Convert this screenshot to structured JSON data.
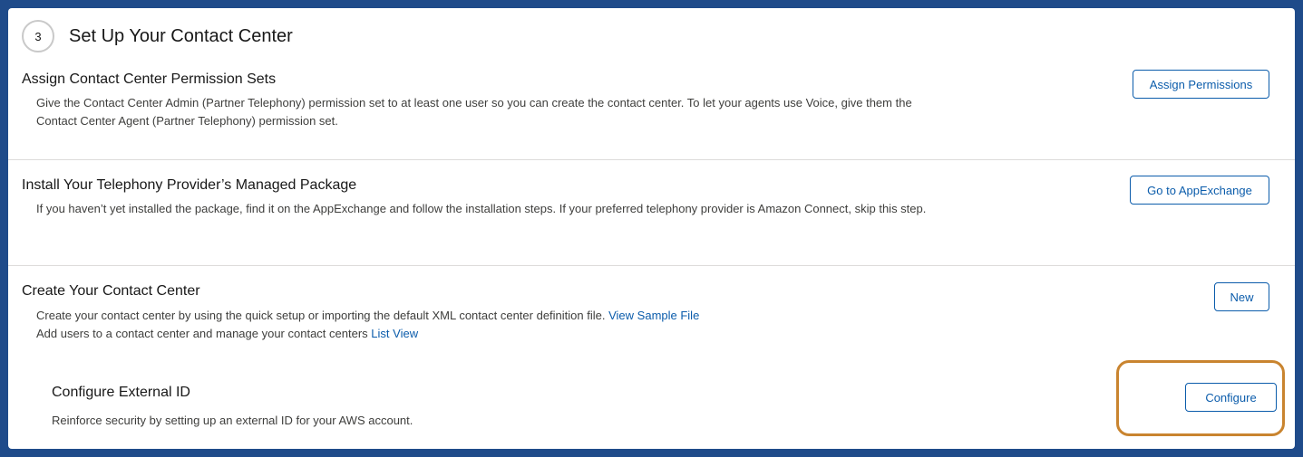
{
  "step": {
    "number": "3",
    "title": "Set Up Your Contact Center"
  },
  "sections": {
    "permissions": {
      "title": "Assign Contact Center Permission Sets",
      "description": "Give the Contact Center Admin (Partner Telephony) permission set to at least one user so you can create the contact center. To let your agents use Voice, give them the Contact Center Agent (Partner Telephony) permission set.",
      "button_label": "Assign Permissions"
    },
    "package": {
      "title": "Install Your Telephony Provider’s Managed Package",
      "description": "If you haven’t yet installed the package, find it on the AppExchange and follow the installation steps. If your preferred telephony provider is Amazon Connect, skip this step.",
      "button_label": "Go to AppExchange"
    },
    "contact_center": {
      "title": "Create Your Contact Center",
      "line1_text": "Create your contact center by using the quick setup or importing the default XML contact center definition file.",
      "line1_link": "View Sample File",
      "line2_text": "Add users to a contact center and manage your contact centers",
      "line2_link": "List View",
      "button_label": "New"
    },
    "external_id": {
      "title": "Configure External ID",
      "description": "Reinforce security by setting up an external ID for your AWS account.",
      "button_label": "Configure"
    }
  },
  "colors": {
    "link": "#0b5cab",
    "highlight": "#c9842f",
    "frame": "#1f4b8a"
  }
}
